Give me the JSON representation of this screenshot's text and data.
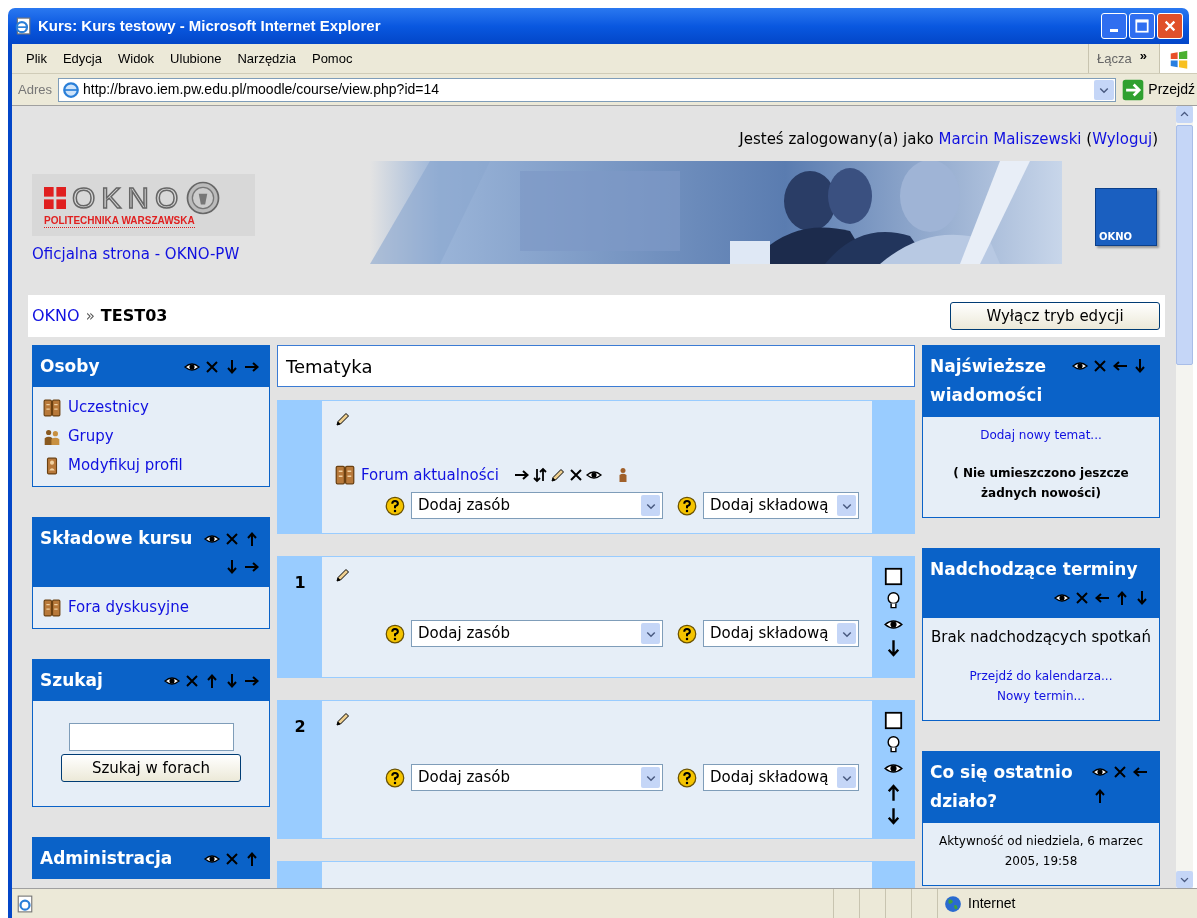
{
  "window": {
    "title": "Kurs: Kurs testowy - Microsoft Internet Explorer"
  },
  "menu": [
    "Plik",
    "Edycja",
    "Widok",
    "Ulubione",
    "Narzędzia",
    "Pomoc"
  ],
  "links_toolbar": {
    "label": "Łącza",
    "more": "»"
  },
  "address_bar": {
    "label": "Adres",
    "url": "http://bravo.iem.pw.edu.pl/moodle/course/view.php?id=14",
    "go": "Przejdź"
  },
  "login": {
    "prefix": "Jesteś zalogowany(a) jako",
    "user": "Marcin Maliszewski",
    "open": "(",
    "logout": "Wyloguj",
    "close": ")"
  },
  "logo": {
    "wordmark": "OKNO",
    "subtitle": "POLITECHNIKA WARSZAWSKA",
    "link": "Oficjalna strona - OKNO-PW"
  },
  "badge": {
    "label": "OKNO"
  },
  "breadcrumb": {
    "home": "OKNO",
    "separator": "»",
    "current": "TEST03"
  },
  "edit_button": "Wyłącz tryb edycji",
  "left_blocks": [
    {
      "title": "Osoby",
      "items": [
        {
          "kind": "participants",
          "label": "Uczestnicy"
        },
        {
          "kind": "groups",
          "label": "Grupy"
        },
        {
          "kind": "profile",
          "label": "Modyfikuj profil"
        }
      ]
    },
    {
      "title": "Składowe kursu",
      "items": [
        {
          "kind": "forum",
          "label": "Fora dyskusyjne"
        }
      ]
    },
    {
      "title": "Szukaj",
      "items": [
        {
          "kind": "search",
          "button": "Szukaj w forach"
        }
      ]
    },
    {
      "title": "Administracja"
    }
  ],
  "topic_header": "Tematyka",
  "sections": [
    {
      "activities": [
        {
          "kind": "forum",
          "label": "Forum aktualności"
        }
      ],
      "add_resource": "Dodaj zasób",
      "add_activity": "Dodaj składową"
    },
    {
      "number": "1",
      "add_resource": "Dodaj zasób",
      "add_activity": "Dodaj składową"
    },
    {
      "number": "2",
      "add_resource": "Dodaj zasób",
      "add_activity": "Dodaj składową"
    }
  ],
  "right_blocks": [
    {
      "title": "Najświeższe wiadomości",
      "items": [
        {
          "kind": "link",
          "text": "Dodaj nowy temat..."
        },
        {
          "kind": "note",
          "text": "( Nie umieszczono jeszcze żadnych nowości)"
        }
      ]
    },
    {
      "title": "Nadchodzące terminy",
      "items": [
        {
          "kind": "text",
          "text": "Brak nadchodzących spotkań"
        },
        {
          "kind": "link",
          "text": "Przejdź do kalendarza..."
        },
        {
          "kind": "link",
          "text": "Nowy termin..."
        }
      ]
    },
    {
      "title": "Co się ostatnio działo?",
      "items": [
        {
          "kind": "small",
          "text": "Aktywność od niedziela, 6 marzec 2005, 19:58"
        }
      ]
    }
  ],
  "status_bar": {
    "zone": "Internet"
  }
}
